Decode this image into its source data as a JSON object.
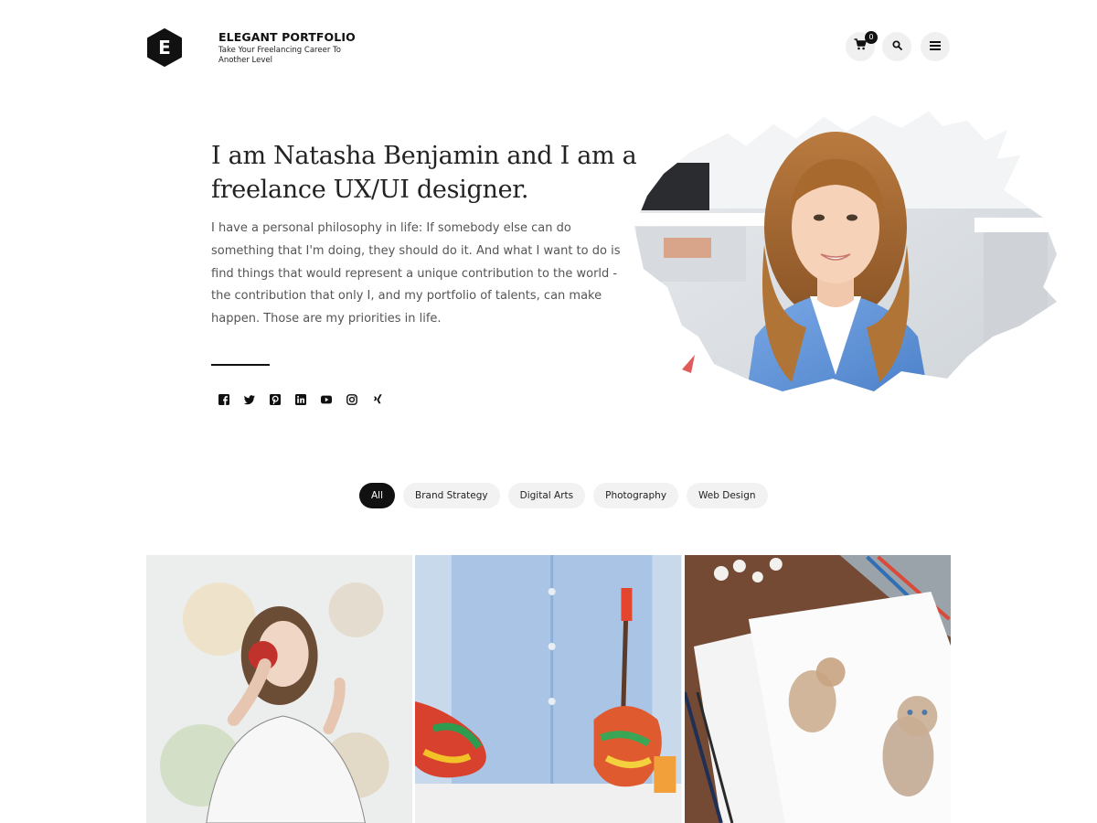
{
  "header": {
    "logo_letter": "E",
    "site_title": "ELEGANT PORTFOLIO",
    "tagline": "Take Your Freelancing Career To Another Level",
    "cart_count": "0",
    "icons": [
      "cart-icon",
      "search-icon",
      "menu-icon"
    ]
  },
  "hero": {
    "heading": "I am Natasha Benjamin and I am a freelance UX/UI designer.",
    "text": "I have a personal philosophy in life: If somebody else can do something that I'm doing, they should do it. And what I want to do is find things that would represent a unique contribution to the world - the contribution that only I, and my portfolio of talents, can make happen. Those are my priorities in life.",
    "socials": [
      "facebook-icon",
      "twitter-icon",
      "pinterest-icon",
      "linkedin-icon",
      "youtube-icon",
      "instagram-icon",
      "xing-icon"
    ]
  },
  "filters": {
    "items": [
      {
        "label": "All",
        "active": true
      },
      {
        "label": "Brand Strategy",
        "active": false
      },
      {
        "label": "Digital Arts",
        "active": false
      },
      {
        "label": "Photography",
        "active": false
      },
      {
        "label": "Web Design",
        "active": false
      }
    ]
  },
  "colors": {
    "accent": "#111111",
    "pill_bg": "#f2f2f2",
    "icon_btn_bg": "#f0f0f0",
    "jacket_blue": "#5b8fd4"
  }
}
